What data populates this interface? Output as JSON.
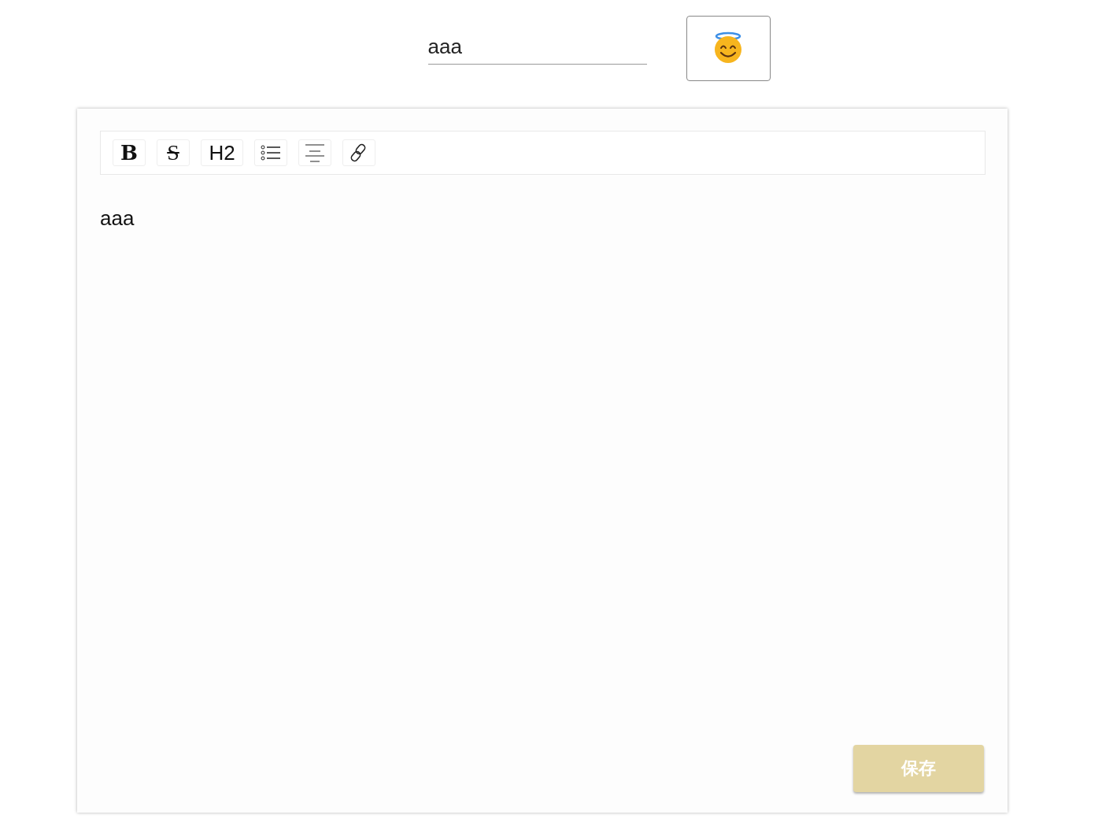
{
  "title_field": {
    "value": "aaa"
  },
  "toolbar": [
    {
      "kind": "bold",
      "label": "B"
    },
    {
      "kind": "strike",
      "label": "S"
    },
    {
      "kind": "heading",
      "label": "H2"
    },
    {
      "kind": "list"
    },
    {
      "kind": "align"
    },
    {
      "kind": "link"
    }
  ],
  "editor": {
    "content": "aaa"
  },
  "save_button": {
    "label": "保存"
  }
}
